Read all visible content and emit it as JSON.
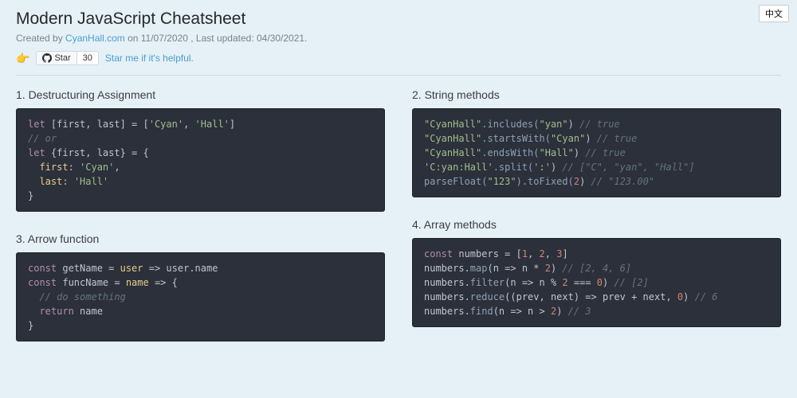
{
  "lang_btn": "中文",
  "title": "Modern JavaScript Cheatsheet",
  "subtitle_prefix": "Created by ",
  "author": "CyanHall.com",
  "subtitle_dates": " on 11/07/2020 , Last updated: 04/30/2021.",
  "pointer": "👉",
  "star_label": "Star",
  "star_count": "30",
  "star_link": "Star me if it's helpful.",
  "sections": {
    "s1": {
      "title": "1. Destructuring Assignment"
    },
    "s2": {
      "title": "2. String methods"
    },
    "s3": {
      "title": "3. Arrow function"
    },
    "s4": {
      "title": "4. Array methods"
    }
  },
  "code": {
    "c1": {
      "l1_kw": "let",
      "l1_var": " [first, last] = [",
      "l1_s1": "'Cyan'",
      "l1_c": ", ",
      "l1_s2": "'Hall'",
      "l1_end": "]",
      "l2": "// or",
      "l3_kw": "let",
      "l3_rest": " {first, last} = {",
      "l4_k": "  first",
      "l4_c": ": ",
      "l4_v": "'Cyan'",
      "l4_e": ",",
      "l5_k": "  last",
      "l5_c": ": ",
      "l5_v": "'Hall'",
      "l6": "}"
    },
    "c2": {
      "l1_s": "\"CyanHall\"",
      "l1_f": ".includes(",
      "l1_a": "\"yan\"",
      "l1_p": ") ",
      "l1_c": "// true",
      "l2_s": "\"CyanHall\"",
      "l2_f": ".startsWith(",
      "l2_a": "\"Cyan\"",
      "l2_p": ") ",
      "l2_c": "// true",
      "l3_s": "\"CyanHall\"",
      "l3_f": ".endsWith(",
      "l3_a": "\"Hall\"",
      "l3_p": ") ",
      "l3_c": "// true",
      "l4_s": "'C:yan:Hall'",
      "l4_f": ".split(",
      "l4_a": "':'",
      "l4_p": ") ",
      "l4_c": "// [\"C\", \"yan\", \"Hall\"]",
      "l5_f": "parseFloat(",
      "l5_a": "\"123\"",
      "l5_m": ").toFixed(",
      "l5_n": "2",
      "l5_p": ") ",
      "l5_c": "// \"123.00\""
    },
    "c3": {
      "l1_kw": "const",
      "l1_n": " getName = ",
      "l1_p": "user",
      "l1_a": " => ",
      "l1_r": "user.name",
      "l2_kw": "const",
      "l2_n": " funcName = ",
      "l2_p": "name",
      "l2_a": " => {",
      "l3": "  // do something",
      "l4_kw": "  return",
      "l4_r": " name",
      "l5": "}"
    },
    "c4": {
      "l1_kw": "const",
      "l1_n": " numbers = [",
      "l1_n1": "1",
      "l1_c1": ", ",
      "l1_n2": "2",
      "l1_c2": ", ",
      "l1_n3": "3",
      "l1_e": "]",
      "l2_o": "numbers.",
      "l2_f": "map",
      "l2_p": "(n => n * ",
      "l2_n": "2",
      "l2_e": ") ",
      "l2_c": "// [2, 4, 6]",
      "l3_o": "numbers.",
      "l3_f": "filter",
      "l3_p": "(n => n % ",
      "l3_n1": "2",
      "l3_m": " === ",
      "l3_n2": "0",
      "l3_e": ") ",
      "l3_c": "// [2]",
      "l4_o": "numbers.",
      "l4_f": "reduce",
      "l4_p": "((prev, next) => prev + next, ",
      "l4_n": "0",
      "l4_e": ") ",
      "l4_c": "// 6",
      "l5_o": "numbers.",
      "l5_f": "find",
      "l5_p": "(n => n > ",
      "l5_n": "2",
      "l5_e": ") ",
      "l5_c": "// 3"
    }
  }
}
